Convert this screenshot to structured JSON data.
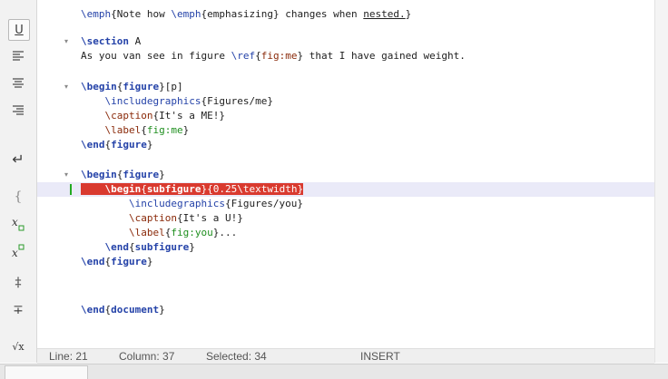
{
  "toolbar": {
    "buttons": [
      {
        "name": "underline-icon",
        "glyph": "U"
      },
      {
        "name": "align-left-icon",
        "glyph": ""
      },
      {
        "name": "align-center-icon",
        "glyph": ""
      },
      {
        "name": "align-right-icon",
        "glyph": ""
      },
      {
        "name": "newline-icon",
        "glyph": "↵"
      },
      {
        "name": "brace-icon",
        "glyph": "{"
      },
      {
        "name": "subscript-icon",
        "glyph": "x□"
      },
      {
        "name": "superscript-icon",
        "glyph": "x□"
      },
      {
        "name": "dagger-icon",
        "glyph": "‡"
      },
      {
        "name": "strikethrough-icon",
        "glyph": "∓"
      },
      {
        "name": "sqrt-icon",
        "glyph": "√x"
      }
    ]
  },
  "editor": {
    "lines": [
      {
        "text": "\\emph{Note how \\emph{emphasizing} changes when nested.}"
      },
      {
        "text": ""
      },
      {
        "text": "\\section A"
      },
      {
        "text": "As you van see in figure \\ref{fig:me} that I have gained weight."
      },
      {
        "text": ""
      },
      {
        "text": "\\begin{figure}[p]"
      },
      {
        "text": "    \\includegraphics{Figures/me}"
      },
      {
        "text": "    \\caption{It's a ME!}"
      },
      {
        "text": "    \\label{fig:me}"
      },
      {
        "text": "\\end{figure}"
      },
      {
        "text": ""
      },
      {
        "text": "\\begin{figure}"
      },
      {
        "text": "    \\begin{subfigure}{0.25\\textwidth}"
      },
      {
        "text": "        \\includegraphics{Figures/you}"
      },
      {
        "text": "        \\caption{It's a U!}"
      },
      {
        "text": "        \\label{fig:you}..."
      },
      {
        "text": "    \\end{subfigure}"
      },
      {
        "text": "\\end{figure}"
      },
      {
        "text": ""
      },
      {
        "text": ""
      },
      {
        "text": "\\end{document}"
      }
    ]
  },
  "status": {
    "line_label": "Line: 21",
    "column_label": "Column: 37",
    "selected_label": "Selected: 34",
    "mode_label": "INSERT"
  },
  "colors": {
    "command": "#2442a8",
    "argument": "#8a2a0a",
    "text_arg": "#1f8f1f",
    "selection": "#d93a2f",
    "current_line": "#eaeaf8"
  }
}
